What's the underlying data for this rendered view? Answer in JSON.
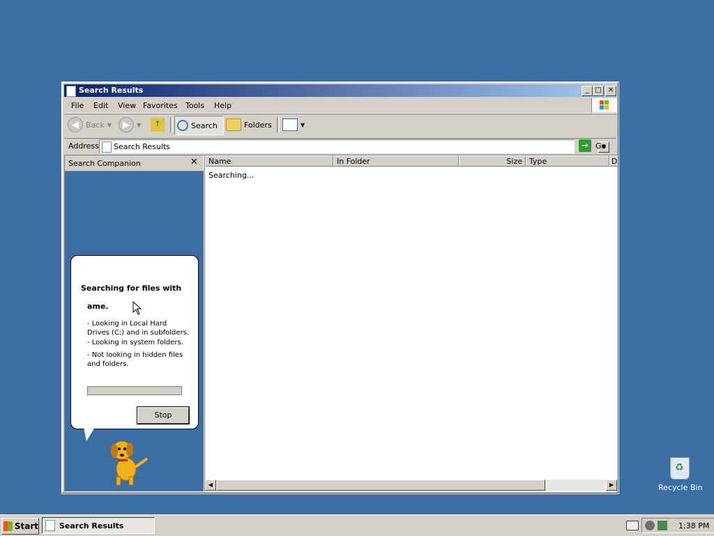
{
  "window": {
    "title": "Search Results"
  },
  "menu": [
    "File",
    "Edit",
    "View",
    "Favorites",
    "Tools",
    "Help"
  ],
  "toolbar": {
    "back": "Back",
    "search": "Search",
    "folders": "Folders"
  },
  "address": {
    "label": "Address",
    "value": "Search Results",
    "go": "Go"
  },
  "companion": {
    "title": "Search Companion",
    "heading": "Searching for files with",
    "heading2": "ame.",
    "lines": [
      "- Looking in Local Hard Drives (C:) and in subfolders.",
      "- Looking in system folders.",
      "- Not looking in hidden files and folders."
    ],
    "stop": "Stop",
    "progress": 0
  },
  "results": {
    "columns": [
      "Name",
      "In Folder",
      "Size",
      "Type",
      "D"
    ],
    "status": "Searching..."
  },
  "desktop": {
    "recycle_bin": "Recycle Bin"
  },
  "taskbar": {
    "start": "Start",
    "task": "Search Results",
    "clock": "1:38 PM"
  },
  "colors": {
    "desktop": "#3a6ea5",
    "title_start": "#0a246a",
    "title_end": "#a6caf0"
  }
}
